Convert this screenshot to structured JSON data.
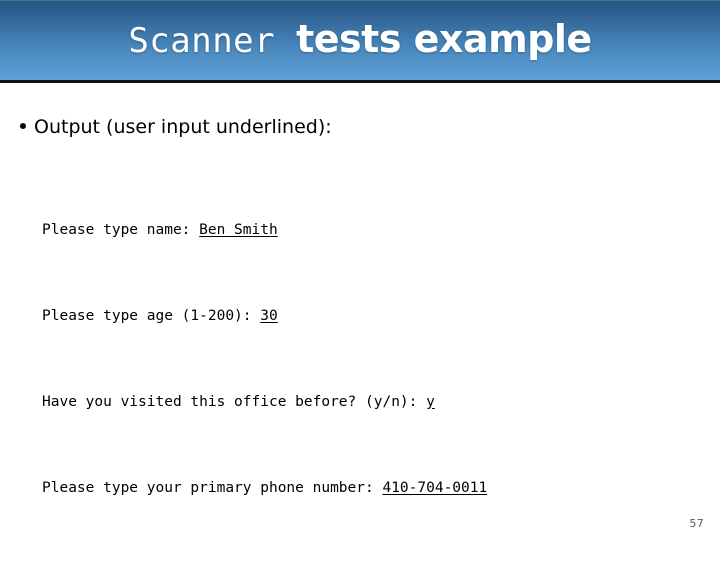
{
  "slide": {
    "title": {
      "mono_part": "Scanner",
      "bold_part": "tests example"
    },
    "bullet": {
      "label": "Output (user input underlined):"
    },
    "console": {
      "lines": [
        {
          "prompt": "Please type name: ",
          "input": "Ben Smith"
        },
        {
          "prompt": "Please type age (1-200): ",
          "input": "30"
        },
        {
          "prompt": "Have you visited this office before? (y/n): ",
          "input": "y"
        },
        {
          "prompt": "Please type your primary phone number: ",
          "input": "410-704-0011"
        }
      ]
    },
    "slide_number": "57",
    "colors": {
      "banner_top": "#26537f",
      "banner_bottom": "#5ea0d7",
      "banner_border": "#0f0f17",
      "title_text": "#ffffff",
      "body_text": "#000000",
      "slide_number_text": "#595959",
      "background": "#ffffff"
    }
  }
}
